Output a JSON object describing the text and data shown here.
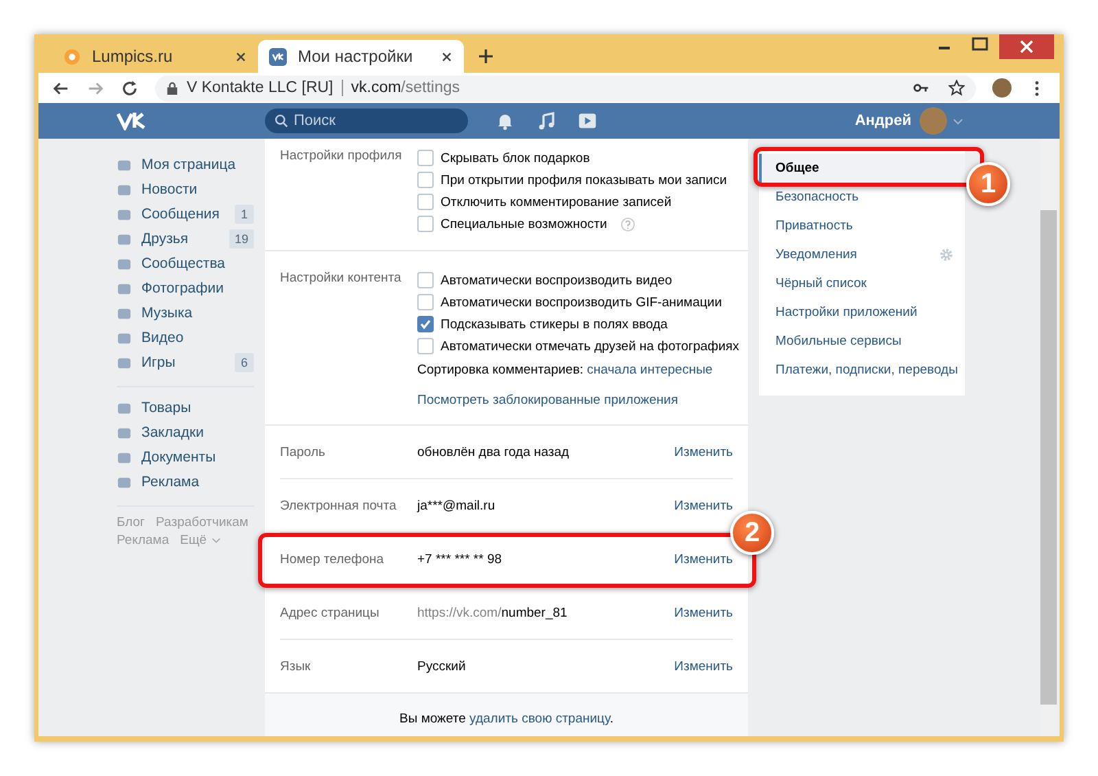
{
  "browser": {
    "tabs": [
      {
        "title": "Lumpics.ru",
        "selected": false
      },
      {
        "title": "Мои настройки",
        "selected": true
      }
    ],
    "site_identity": "V Kontakte LLC [RU]",
    "url_host": "vk.com",
    "url_path": "/settings"
  },
  "header": {
    "search_placeholder": "Поиск",
    "user_name": "Андрей"
  },
  "left_nav": {
    "items": [
      {
        "label": "Моя страница"
      },
      {
        "label": "Новости"
      },
      {
        "label": "Сообщения",
        "count": "1"
      },
      {
        "label": "Друзья",
        "count": "19"
      },
      {
        "label": "Сообщества"
      },
      {
        "label": "Фотографии"
      },
      {
        "label": "Музыка"
      },
      {
        "label": "Видео"
      },
      {
        "label": "Игры",
        "count": "6"
      }
    ],
    "secondary": [
      {
        "label": "Товары"
      },
      {
        "label": "Закладки"
      },
      {
        "label": "Документы"
      },
      {
        "label": "Реклама"
      }
    ],
    "footer_links": [
      "Блог",
      "Разработчикам",
      "Реклама",
      "Ещё"
    ]
  },
  "settings": {
    "sections": [
      {
        "title": "Настройки профиля",
        "options": [
          {
            "label": "Скрывать блок подарков",
            "checked": false
          },
          {
            "label": "При открытии профиля показывать мои записи",
            "checked": false
          },
          {
            "label": "Отключить комментирование записей",
            "checked": false
          },
          {
            "label": "Специальные возможности",
            "checked": false,
            "has_help": true
          }
        ]
      },
      {
        "title": "Настройки контента",
        "options": [
          {
            "label": "Автоматически воспроизводить видео",
            "checked": false
          },
          {
            "label": "Автоматически воспроизводить GIF-анимации",
            "checked": false
          },
          {
            "label": "Подсказывать стикеры в полях ввода",
            "checked": true
          },
          {
            "label": "Автоматически отмечать друзей на фотографиях",
            "checked": false
          }
        ],
        "sort_label": "Сортировка комментариев:",
        "sort_value": "сначала интересные",
        "link": "Посмотреть заблокированные приложения"
      }
    ],
    "rows": [
      {
        "label": "Пароль",
        "value": "обновлён два года назад",
        "action": "Изменить"
      },
      {
        "label": "Электронная почта",
        "value": "ja***@mail.ru",
        "action": "Изменить"
      },
      {
        "label": "Номер телефона",
        "value": "+7 *** *** ** 98",
        "action": "Изменить",
        "callout": "2"
      },
      {
        "label": "Адрес страницы",
        "value_prefix": "https://vk.com/",
        "value": "number_81",
        "action": "Изменить"
      },
      {
        "label": "Язык",
        "value": "Русский",
        "action": "Изменить"
      }
    ],
    "footer": {
      "text": "Вы можете",
      "link": "удалить свою страницу",
      "suffix": "."
    }
  },
  "right_menu": {
    "items": [
      {
        "label": "Общее",
        "selected": true,
        "callout": "1"
      },
      {
        "label": "Безопасность",
        "selected": false
      },
      {
        "label": "Приватность",
        "selected": false
      },
      {
        "label": "Уведомления",
        "selected": false,
        "has_settings": true
      },
      {
        "label": "Чёрный список",
        "selected": false
      },
      {
        "label": "Настройки приложений",
        "selected": false
      },
      {
        "label": "Мобильные сервисы",
        "selected": false
      },
      {
        "label": "Платежи, подписки, переводы",
        "selected": false
      }
    ]
  }
}
